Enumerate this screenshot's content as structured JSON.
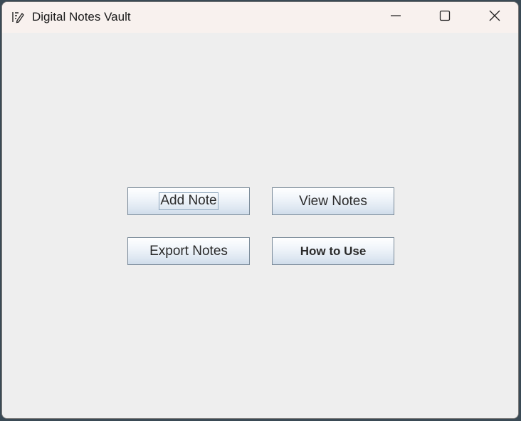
{
  "window": {
    "title": "Digital Notes Vault",
    "app_icon": "notes-edit-icon",
    "controls": {
      "minimize": "minimize-icon",
      "maximize": "maximize-icon",
      "close": "close-icon"
    }
  },
  "buttons": {
    "add_note": "Add Note",
    "view_notes": "View Notes",
    "export_notes": "Export Notes",
    "how_to_use": "How to Use"
  },
  "colors": {
    "titlebar_bg": "#f8f1ee",
    "content_bg": "#eeeeee",
    "button_border": "#7a8a99"
  }
}
